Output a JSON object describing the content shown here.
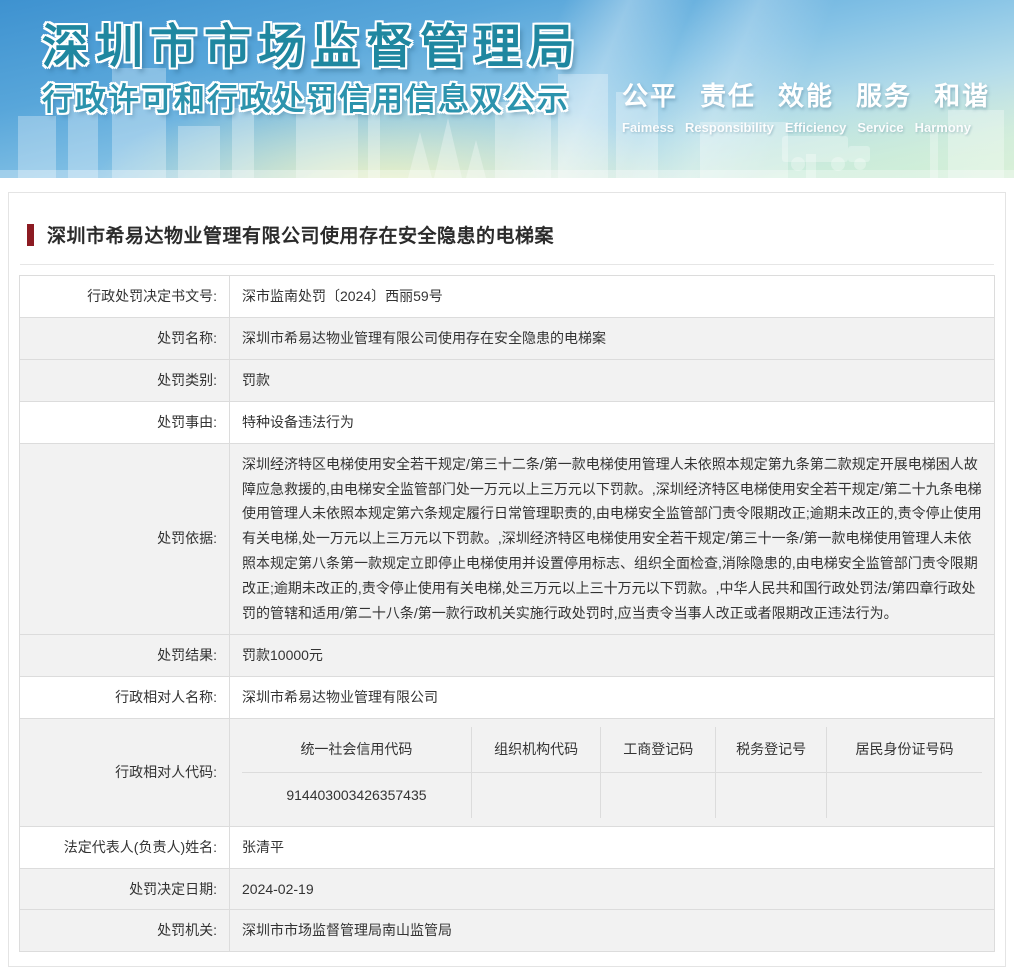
{
  "colors": {
    "accent-red": "#8c1b22",
    "row-shade": "#f2f2f2",
    "banner-teal": "#1f87a0",
    "banner-blue": "#3e92d0"
  },
  "banner": {
    "title": "深圳市市场监督管理局",
    "subtitle": "行政许可和行政处罚信用信息双公示",
    "motto_cn": [
      "公平",
      "责任",
      "效能",
      "服务",
      "和谐"
    ],
    "motto_en": [
      "Faimess",
      "Responsibility",
      "Efficiency",
      "Service",
      "Harmony"
    ]
  },
  "case": {
    "title": "深圳市希易达物业管理有限公司使用存在安全隐患的电梯案"
  },
  "table": {
    "rows": [
      {
        "label": "行政处罚决定书文号:",
        "value": "深市监南处罚〔2024〕西丽59号"
      },
      {
        "label": "处罚名称:",
        "value": "深圳市希易达物业管理有限公司使用存在安全隐患的电梯案"
      },
      {
        "label": "处罚类别:",
        "value": "罚款"
      },
      {
        "label": "处罚事由:",
        "value": "特种设备违法行为"
      },
      {
        "label": "处罚依据:",
        "value": "深圳经济特区电梯使用安全若干规定/第三十二条/第一款电梯使用管理人未依照本规定第九条第二款规定开展电梯困人故障应急救援的,由电梯安全监管部门处一万元以上三万元以下罚款。,深圳经济特区电梯使用安全若干规定/第二十九条电梯使用管理人未依照本规定第六条规定履行日常管理职责的,由电梯安全监管部门责令限期改正;逾期未改正的,责令停止使用有关电梯,处一万元以上三万元以下罚款。,深圳经济特区电梯使用安全若干规定/第三十一条/第一款电梯使用管理人未依照本规定第八条第一款规定立即停止电梯使用并设置停用标志、组织全面检查,消除隐患的,由电梯安全监管部门责令限期改正;逾期未改正的,责令停止使用有关电梯,处三万元以上三十万元以下罚款。,中华人民共和国行政处罚法/第四章行政处罚的管辖和适用/第二十八条/第一款行政机关实施行政处罚时,应当责令当事人改正或者限期改正违法行为。"
      },
      {
        "label": "处罚结果:",
        "value": "罚款10000元"
      },
      {
        "label": "行政相对人名称:",
        "value": "深圳市希易达物业管理有限公司"
      },
      {
        "label": "法定代表人(负责人)姓名:",
        "value": "张清平"
      },
      {
        "label": "处罚决定日期:",
        "value": "2024-02-19"
      },
      {
        "label": "处罚机关:",
        "value": "深圳市市场监督管理局南山监管局"
      }
    ],
    "code_row": {
      "label": "行政相对人代码:",
      "headers": [
        "统一社会信用代码",
        "组织机构代码",
        "工商登记码",
        "税务登记号",
        "居民身份证号码"
      ],
      "values": [
        "914403003426357435",
        "",
        "",
        "",
        ""
      ]
    }
  }
}
